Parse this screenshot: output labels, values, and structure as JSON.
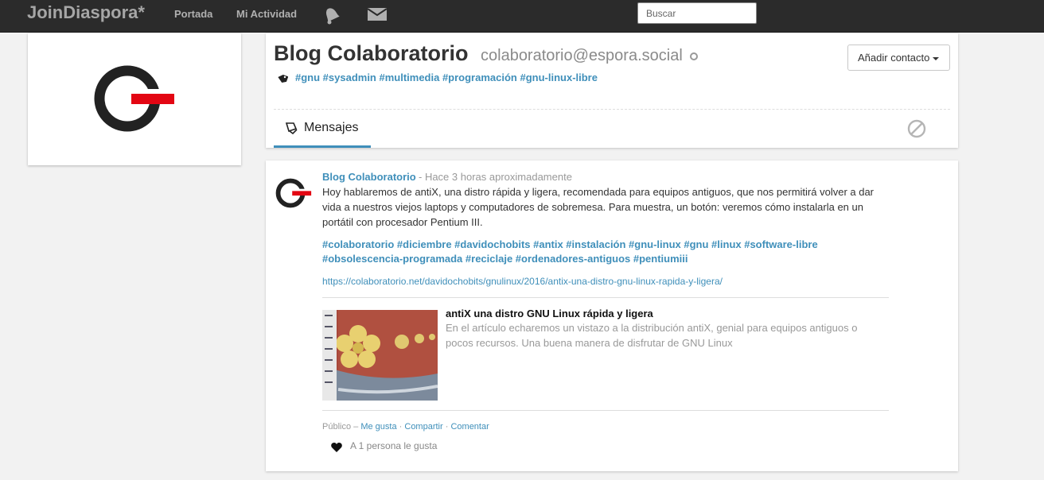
{
  "topbar": {
    "brand": "JoinDiaspora*",
    "nav": {
      "home": "Portada",
      "activity": "Mi Actividad"
    },
    "icons": {
      "notifications": "bell-icon",
      "messages": "mail-icon"
    },
    "search_placeholder": "Buscar"
  },
  "profile": {
    "name": "Blog Colaboratorio",
    "handle": "colaboratorio@espora.social",
    "tags": "#gnu #sysadmin #multimedia #programación #gnu-linux-libre",
    "add_contact_label": "Añadir contacto",
    "tabs": [
      {
        "label": "Mensajes",
        "icon": "posts-icon"
      }
    ]
  },
  "post": {
    "author": "Blog Colaboratorio",
    "time": "- Hace 3 horas aproximadamente",
    "body": "Hoy hablaremos de antiX, una distro rápida y ligera, recomendada para equipos antiguos, que nos permitirá volver a dar vida a nuestros viejos laptops y computadores de sobremesa. Para muestra, un botón: veremos cómo instalarla en un portátil con procesador Pentium III.",
    "tags_line1": "#colaboratorio #diciembre #davidochobits #antix #instalación #gnu-linux #gnu #linux #software-libre",
    "tags_line2": "#obsolescencia-programada #reciclaje #ordenadores-antiguos #pentiumiii",
    "link": "https://colaboratorio.net/davidochobits/gnulinux/2016/antix-una-distro-gnu-linux-rapida-y-ligera/",
    "preview": {
      "title": "antiX una distro GNU Linux rápida y ligera",
      "description": "En el artículo echaremos un vistazo a la distribución antiX, genial para equipos antiguos o pocos recursos. Una buena manera de disfrutar de GNU Linux"
    },
    "meta": {
      "visibility": "Público",
      "separator": "–",
      "like": "Me gusta",
      "share": "Compartir",
      "comment": "Comentar",
      "dot": "·"
    },
    "likes": "A 1 persona le gusta"
  },
  "colors": {
    "accent": "#3f8fba",
    "topbar": "#2b2b2b",
    "logo_red": "#e30613"
  }
}
